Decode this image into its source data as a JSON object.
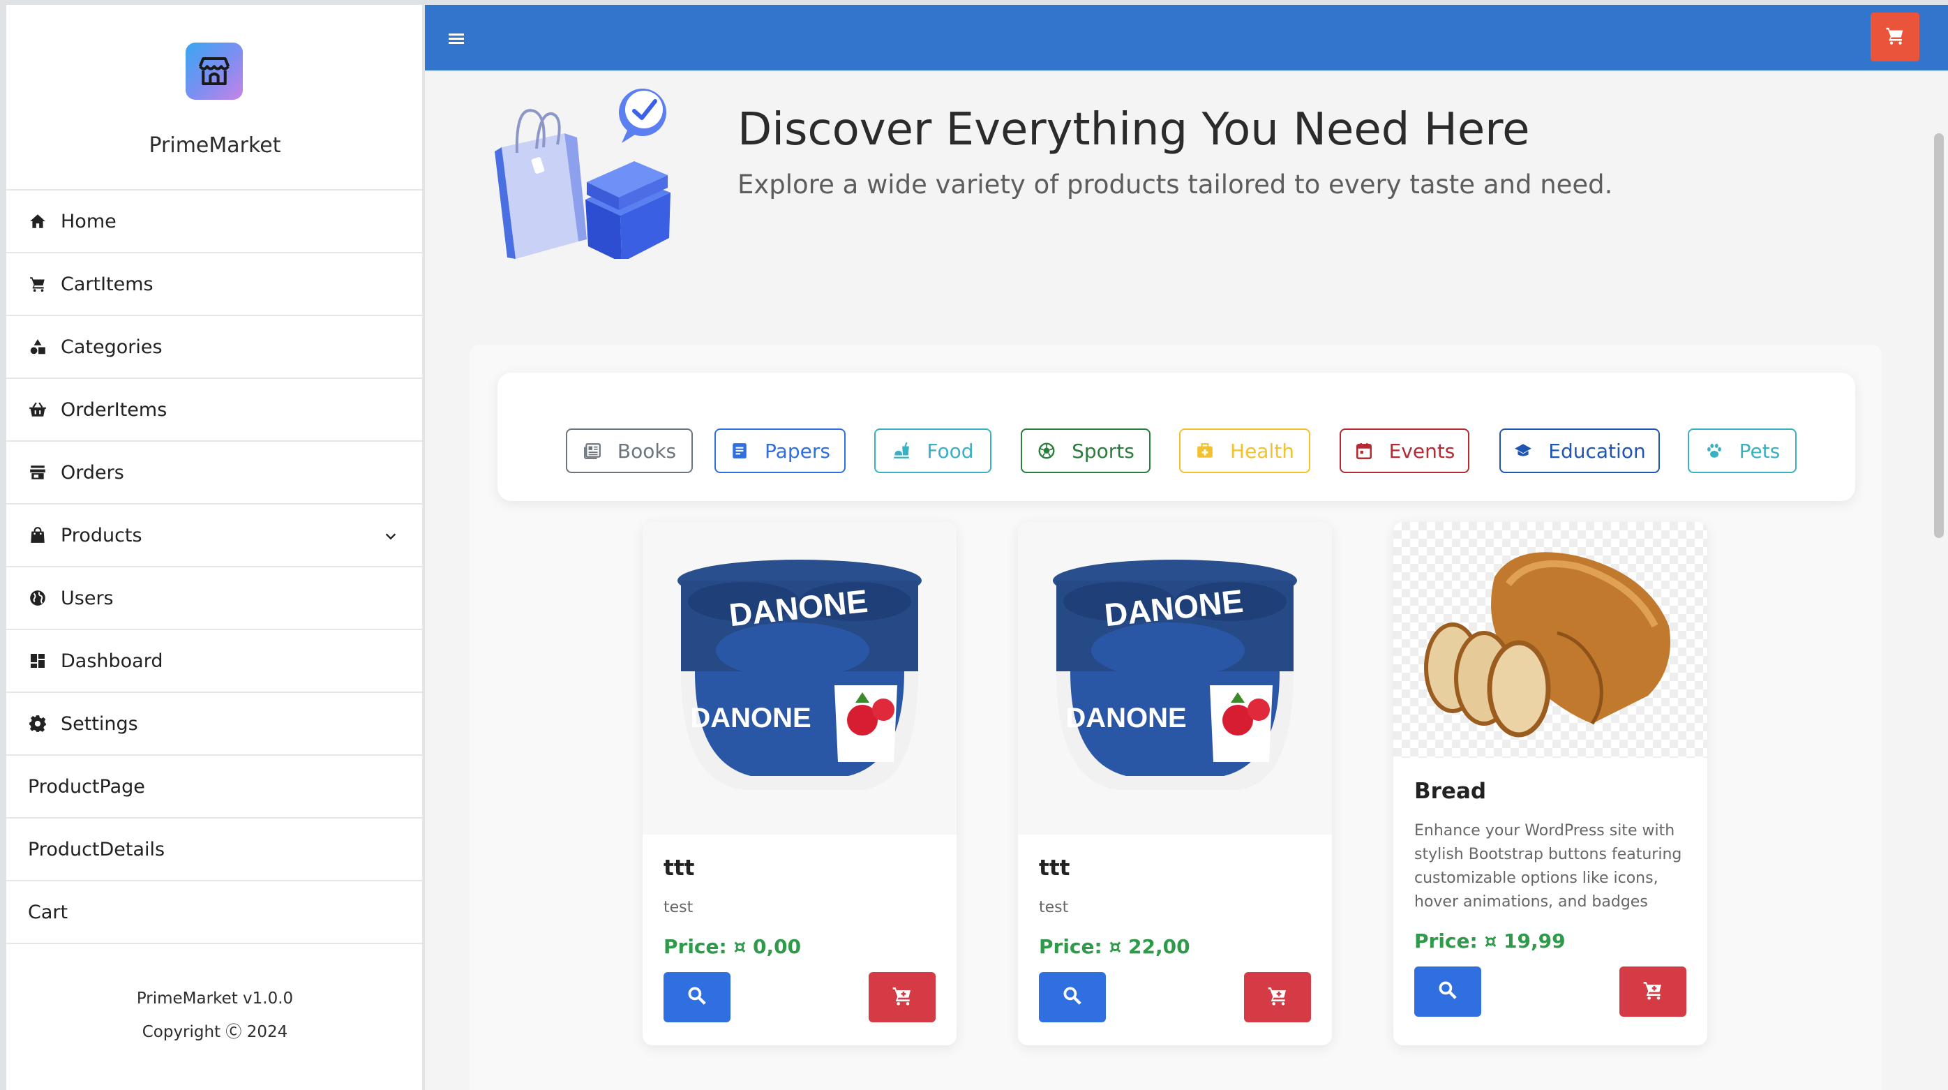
{
  "brand": {
    "name": "PrimeMarket"
  },
  "nav": {
    "items": [
      {
        "label": "Home",
        "icon": "home-icon"
      },
      {
        "label": "CartItems",
        "icon": "cart-icon"
      },
      {
        "label": "Categories",
        "icon": "shapes-icon"
      },
      {
        "label": "OrderItems",
        "icon": "basket-icon"
      },
      {
        "label": "Orders",
        "icon": "store-icon"
      },
      {
        "label": "Products",
        "icon": "bag-icon",
        "expandable": true
      },
      {
        "label": "Users",
        "icon": "globe-icon"
      },
      {
        "label": "Dashboard",
        "icon": "dashboard-icon"
      },
      {
        "label": "Settings",
        "icon": "gear-icon"
      },
      {
        "label": "ProductPage"
      },
      {
        "label": "ProductDetails"
      },
      {
        "label": "Cart"
      }
    ]
  },
  "footer": {
    "version": "PrimeMarket v1.0.0",
    "copyright": "Copyright Ⓒ 2024"
  },
  "hero": {
    "title": "Discover Everything You Need Here",
    "subtitle": "Explore a wide variety of products tailored to every taste and need."
  },
  "categories": [
    {
      "label": "Books",
      "color": "#6c757d",
      "icon": "newspaper-icon"
    },
    {
      "label": "Papers",
      "color": "#2f6fdf",
      "icon": "document-icon"
    },
    {
      "label": "Food",
      "color": "#3ab0c3",
      "icon": "food-icon"
    },
    {
      "label": "Sports",
      "color": "#2a7d3b",
      "icon": "ball-icon"
    },
    {
      "label": "Health",
      "color": "#f2c12e",
      "icon": "medkit-icon"
    },
    {
      "label": "Events",
      "color": "#b52a33",
      "icon": "calendar-icon"
    },
    {
      "label": "Education",
      "color": "#2155b3",
      "icon": "graduation-cap-icon"
    },
    {
      "label": "Pets",
      "color": "#3ab0c3",
      "icon": "paw-icon"
    }
  ],
  "products": [
    {
      "name": "ttt",
      "description": "test",
      "price": "Price: ¤ 0,00",
      "image": "danone-yogurt"
    },
    {
      "name": "ttt",
      "description": "test",
      "price": "Price: ¤ 22,00",
      "image": "danone-yogurt"
    },
    {
      "name": "Bread",
      "description": "Enhance your WordPress site with stylish Bootstrap buttons featuring customizable options like icons, hover animations, and badges",
      "price": "Price: ¤ 19,99",
      "image": "bread"
    }
  ],
  "colors": {
    "topbar": "#3175cd",
    "cart_button": "#e9543a",
    "search_button": "#2f6fdf",
    "add_cart_button": "#d43b45",
    "price": "#2f9a49"
  }
}
